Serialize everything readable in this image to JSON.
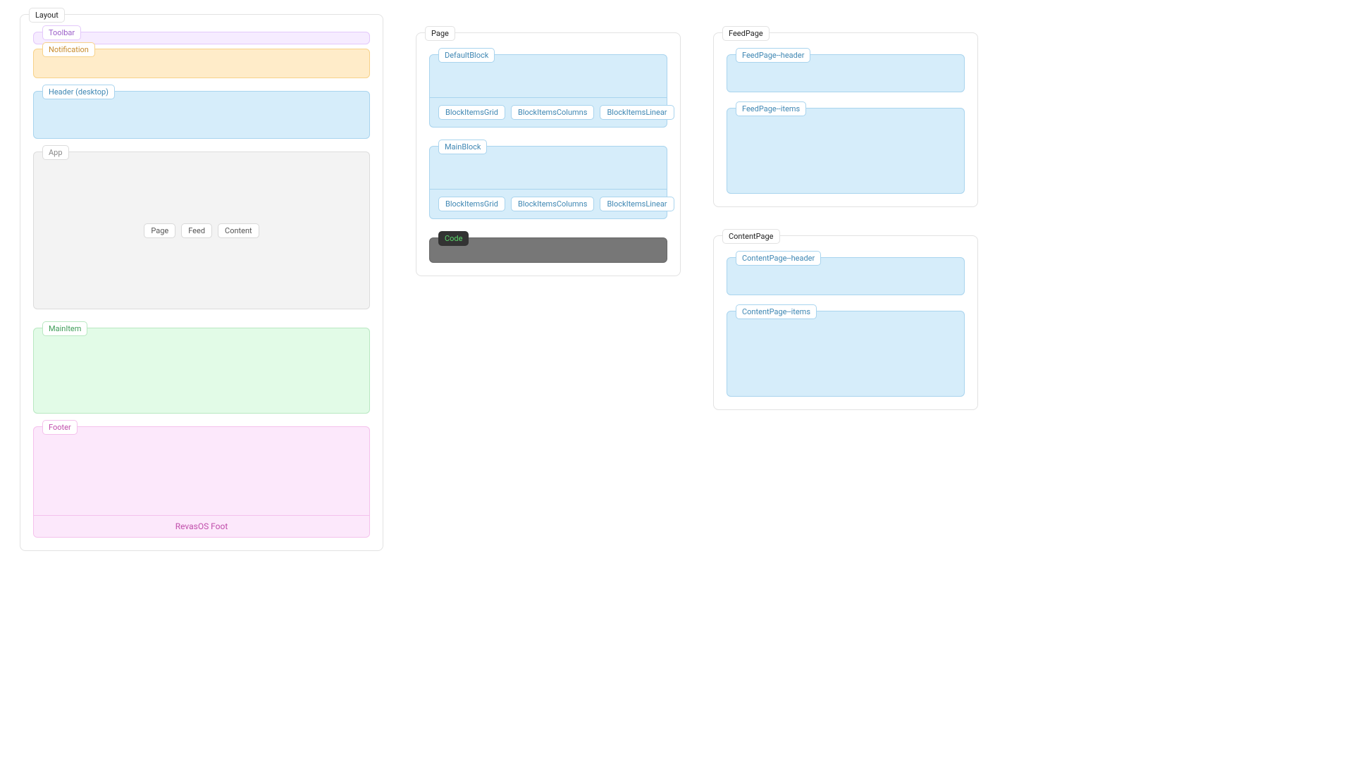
{
  "layout": {
    "tag": "Layout",
    "toolbar": "Toolbar",
    "notification": "Notification",
    "header": "Header (desktop)",
    "app": {
      "tag": "App",
      "chips": [
        "Page",
        "Feed",
        "Content"
      ]
    },
    "mainitem": "MainItem",
    "footer": {
      "tag": "Footer",
      "band": "RevasOS Foot"
    }
  },
  "page": {
    "tag": "Page",
    "defaultblock": {
      "tag": "DefaultBlock",
      "chips": [
        "BlockItemsGrid",
        "BlockItemsColumns",
        "BlockItemsLinear"
      ]
    },
    "mainblock": {
      "tag": "MainBlock",
      "chips": [
        "BlockItemsGrid",
        "BlockItemsColumns",
        "BlockItemsLinear"
      ]
    },
    "code": "Code"
  },
  "feedpage": {
    "tag": "FeedPage",
    "header": "FeedPage--header",
    "items": "FeedPage--items"
  },
  "contentpage": {
    "tag": "ContentPage",
    "header": "ContentPage--header",
    "items": "ContentPage--items"
  }
}
